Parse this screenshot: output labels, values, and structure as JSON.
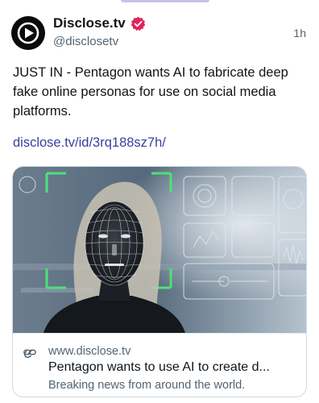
{
  "account": {
    "display_name": "Disclose.tv",
    "handle": "@disclosetv",
    "time_ago": "1h",
    "verified_color": "#e0245e"
  },
  "post": {
    "text": "JUST IN - Pentagon wants AI to fabricate deep fake online personas for use on social media platforms.",
    "link": "disclose.tv/id/3rq188sz7h/"
  },
  "link_card": {
    "image_icon": "deepfake-face-scan-image",
    "domain": "www.disclose.tv",
    "title": "Pentagon wants to use AI to create d...",
    "description": "Breaking news from around the world."
  },
  "colors": {
    "link": "#3b3f9a",
    "muted": "#536471",
    "text": "#0f1419"
  }
}
